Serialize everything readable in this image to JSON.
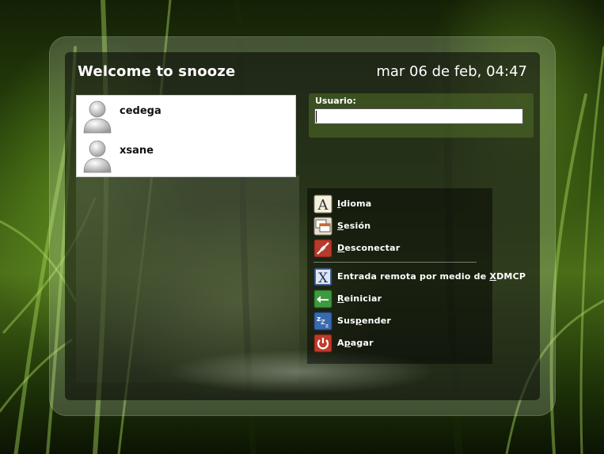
{
  "header": {
    "title": "Welcome to snooze",
    "datetime": "mar 06 de feb, 04:47"
  },
  "users": [
    {
      "name": "cedega"
    },
    {
      "name": "xsane"
    }
  ],
  "login": {
    "label": "Usuario:",
    "value": ""
  },
  "menu": {
    "idioma": {
      "pre": "",
      "acc": "I",
      "post": "dioma"
    },
    "sesion": {
      "pre": "",
      "acc": "S",
      "post": "esión"
    },
    "desconectar": {
      "pre": "",
      "acc": "D",
      "post": "esconectar"
    },
    "xdmcp": {
      "pre": "Entrada remota por medio de ",
      "acc": "X",
      "post": "DMCP"
    },
    "reiniciar": {
      "pre": "",
      "acc": "R",
      "post": "einiciar"
    },
    "suspender": {
      "pre": "Sus",
      "acc": "p",
      "post": "ender"
    },
    "apagar": {
      "pre": "A",
      "acc": "p",
      "post": "agar"
    }
  },
  "icons": {
    "idioma": "language-icon",
    "sesion": "session-icon",
    "desconectar": "disconnect-icon",
    "xdmcp": "remote-login-icon",
    "reiniciar": "restart-icon",
    "suspender": "suspend-icon",
    "apagar": "power-icon"
  },
  "colors": {
    "accent_green": "#5c8a1e",
    "text_white": "#ffffff"
  }
}
